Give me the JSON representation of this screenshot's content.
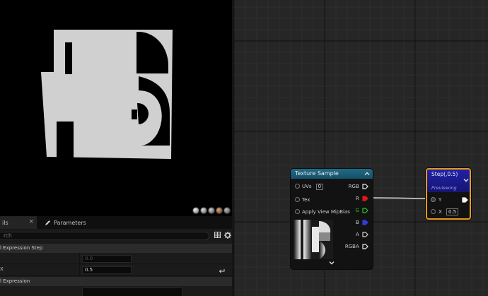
{
  "details_panel": {
    "tabs": [
      {
        "label": "ils"
      },
      {
        "label": "Parameters"
      }
    ],
    "search": {
      "placeholder": "rch"
    },
    "sections": [
      {
        "title": "l Expression Step",
        "rows": [
          {
            "label": "",
            "value": "0.0",
            "disabled": true
          },
          {
            "label": "X",
            "value": "0.5",
            "disabled": false
          }
        ]
      },
      {
        "title": "l Expression"
      }
    ]
  },
  "graph": {
    "texture_sample_node": {
      "title": "Texture Sample",
      "inputs": [
        {
          "label": "UVs",
          "value": "0"
        },
        {
          "label": "Tex"
        },
        {
          "label": "Apply View MipBias"
        }
      ],
      "outputs": [
        {
          "label": "RGB",
          "color": "#e8e8e8"
        },
        {
          "label": "R",
          "color": "#e01818"
        },
        {
          "label": "G",
          "color": "#2fbf2f"
        },
        {
          "label": "B",
          "color": "#2d3fd8"
        },
        {
          "label": "A",
          "color": "#cfcfcf"
        },
        {
          "label": "RGBA",
          "color": "#e8e8e8"
        }
      ]
    },
    "step_node": {
      "title": "Step(,0.5)",
      "subtitle": "Previewing",
      "inputs": [
        {
          "label": "Y"
        },
        {
          "label": "X",
          "value": "0.5"
        }
      ],
      "border_color": "#e79a1a"
    }
  },
  "colors": {
    "graph_background": "#262626",
    "texture_header": "#1f6a86",
    "step_header": "#2121a8",
    "preview_surface": "#d3d3d3"
  }
}
